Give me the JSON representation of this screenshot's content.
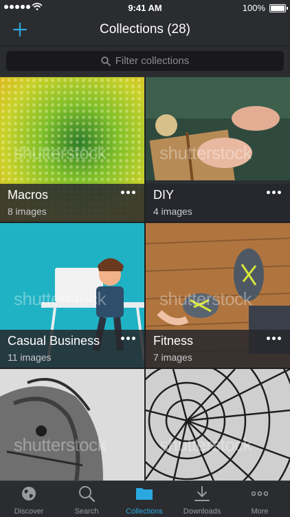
{
  "status": {
    "time": "9:41 AM",
    "battery": "100%"
  },
  "header": {
    "title": "Collections (28)"
  },
  "search": {
    "placeholder": "Filter collections"
  },
  "watermark": "shutterstock",
  "collections": [
    {
      "name": "Macros",
      "count": "8 images"
    },
    {
      "name": "DIY",
      "count": "4 images"
    },
    {
      "name": "Casual Business",
      "count": "11 images"
    },
    {
      "name": "Fitness",
      "count": "7 images"
    },
    {
      "name": "",
      "count": ""
    },
    {
      "name": "",
      "count": ""
    }
  ],
  "tabs": [
    {
      "label": "Discover",
      "icon": "globe-icon"
    },
    {
      "label": "Search",
      "icon": "search-icon"
    },
    {
      "label": "Collections",
      "icon": "folder-icon",
      "active": true
    },
    {
      "label": "Downloads",
      "icon": "download-icon"
    },
    {
      "label": "More",
      "icon": "more-icon"
    }
  ],
  "colors": {
    "accent": "#2aa9e0",
    "bar": "#2b2c2f",
    "background": "#1e1f21"
  }
}
